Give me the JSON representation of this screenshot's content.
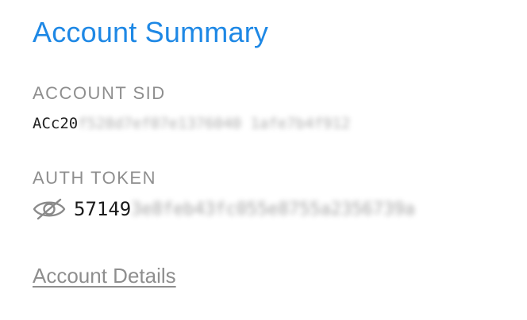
{
  "page": {
    "title": "Account Summary"
  },
  "account_sid": {
    "label": "ACCOUNT SID",
    "visible": "ACc20",
    "masked": "f528d7ef07e1376040 1afe7b4f912"
  },
  "auth_token": {
    "label": "AUTH TOKEN",
    "toggle_icon": "eye-slash-icon",
    "visible": "57149",
    "masked": "3e8feb43fc055e8755a2356739a"
  },
  "links": {
    "account_details": "Account Details"
  },
  "colors": {
    "title": "#1e88e5",
    "label": "#8e8e8e",
    "text": "#222222"
  }
}
